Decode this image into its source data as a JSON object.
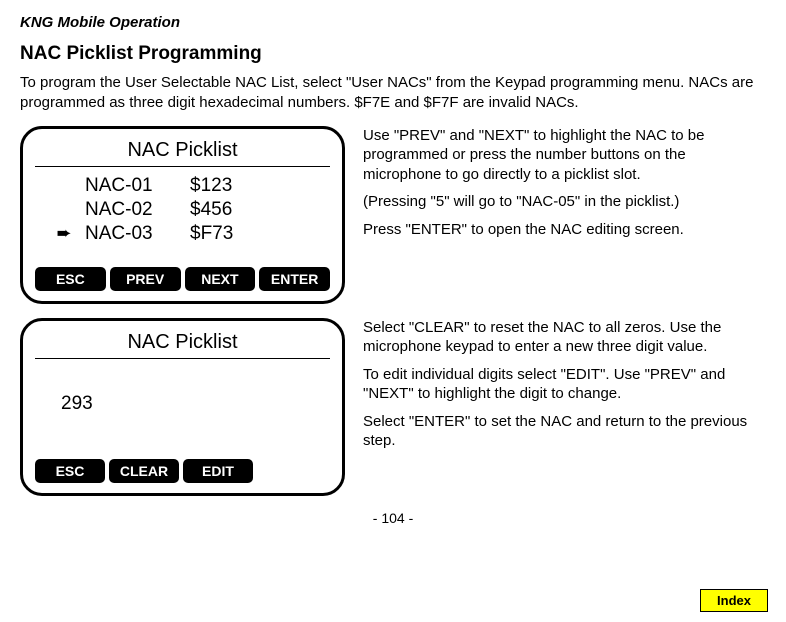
{
  "header": "KNG Mobile Operation",
  "title": "NAC Picklist Programming",
  "intro": "To program the User Selectable NAC List, select \"User NACs\" from the Keypad programming menu. NACs are programmed as three digit hexadecimal numbers. $F7E and $F7F are invalid NACs.",
  "screen1": {
    "title": "NAC Picklist",
    "rows": [
      {
        "arrow": "",
        "label": "NAC-01",
        "val": "$123"
      },
      {
        "arrow": "",
        "label": "NAC-02",
        "val": "$456"
      },
      {
        "arrow": "➨",
        "label": "NAC-03",
        "val": "$F73"
      }
    ],
    "buttons": {
      "b1": "ESC",
      "b2": "PREV",
      "b3": "NEXT",
      "b4": "ENTER"
    }
  },
  "side1": {
    "p1": "Use \"PREV\" and \"NEXT\" to highlight the NAC to be programmed or press the number buttons on the microphone to go directly to a picklist slot.",
    "p2": "(Pressing \"5\" will go to \"NAC-05\" in the picklist.)",
    "p3": "Press \"ENTER\" to open the NAC editing screen."
  },
  "screen2": {
    "title": "NAC Picklist",
    "value": "293",
    "buttons": {
      "b1": "ESC",
      "b2": "CLEAR",
      "b3": "EDIT"
    }
  },
  "side2": {
    "p1": "Select \"CLEAR\" to reset the NAC to all zeros. Use the microphone keypad to enter a new three digit value.",
    "p2": "To edit individual digits select \"EDIT\". Use \"PREV\" and \"NEXT\" to highlight the digit to change.",
    "p3": "Select \"ENTER\" to set the NAC and return to the previous step."
  },
  "pageNum": "- 104 -",
  "indexLabel": "Index"
}
